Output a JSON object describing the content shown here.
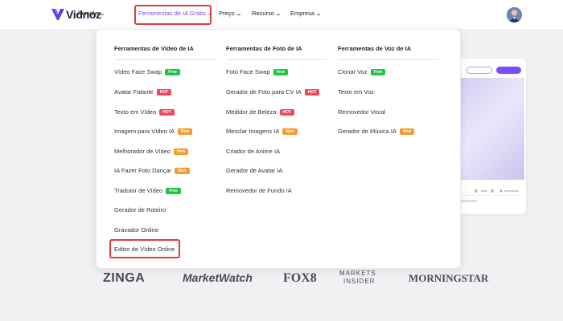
{
  "brand": {
    "name": "Vidnoz",
    "colors": {
      "accent": "#7a4cf5",
      "highlight": "#e33a3a"
    }
  },
  "nav": {
    "items": [
      {
        "label": "Função",
        "active": false
      },
      {
        "label": "Ferramentas de IA Grátis",
        "active": true
      },
      {
        "label": "Preço",
        "active": false
      },
      {
        "label": "Recurso",
        "active": false
      },
      {
        "label": "Empresa",
        "active": false
      }
    ]
  },
  "menu": {
    "columns": [
      {
        "title": "Ferramentas de Vídeo de IA",
        "items": [
          {
            "label": "Vídeo Face Swap",
            "badge": "Free"
          },
          {
            "label": "Avatar Falante",
            "badge": "HOT"
          },
          {
            "label": "Texto em Vídeo",
            "badge": "HOT"
          },
          {
            "label": "Imagem para Vídeo IA",
            "badge": "New"
          },
          {
            "label": "Melhorador de Vídeo",
            "badge": "New"
          },
          {
            "label": "IA Fazer Foto Dançar",
            "badge": "New"
          },
          {
            "label": "Tradutor de Vídeo",
            "badge": "Free"
          },
          {
            "label": "Gerador de Roteiro",
            "badge": ""
          },
          {
            "label": "Gravador Online",
            "badge": ""
          },
          {
            "label": "Editor de Vídeo Online",
            "badge": ""
          }
        ]
      },
      {
        "title": "Ferramentas de Foto de IA",
        "items": [
          {
            "label": "Foto Face Swap",
            "badge": "Free"
          },
          {
            "label": "Gerador de Foto para CV IA",
            "badge": "HOT"
          },
          {
            "label": "Medidor de Beleza",
            "badge": "HOT"
          },
          {
            "label": "Mesclar Imagens IA",
            "badge": "New"
          },
          {
            "label": "Criador de Anime IA",
            "badge": ""
          },
          {
            "label": "Gerador de Avatar IA",
            "badge": ""
          },
          {
            "label": "Removedor de Fundo IA",
            "badge": ""
          }
        ]
      },
      {
        "title": "Ferramentas de Voz de IA",
        "items": [
          {
            "label": "Clonar Voz",
            "badge": "Free"
          },
          {
            "label": "Texto em Voz",
            "badge": ""
          },
          {
            "label": "Removedor Vocal",
            "badge": ""
          },
          {
            "label": "Gerador de Música IA",
            "badge": "New"
          }
        ]
      }
    ]
  },
  "brands": [
    "ZINGA",
    "MarketWatch",
    "FOX8",
    "MARKETS",
    "INSIDER",
    "MORNINGSTAR"
  ],
  "icons": {
    "logo": "vidnoz-logo-icon",
    "chevron": "chevron-down-icon",
    "chevron_up": "chevron-up-icon",
    "avatar": "user-avatar"
  }
}
